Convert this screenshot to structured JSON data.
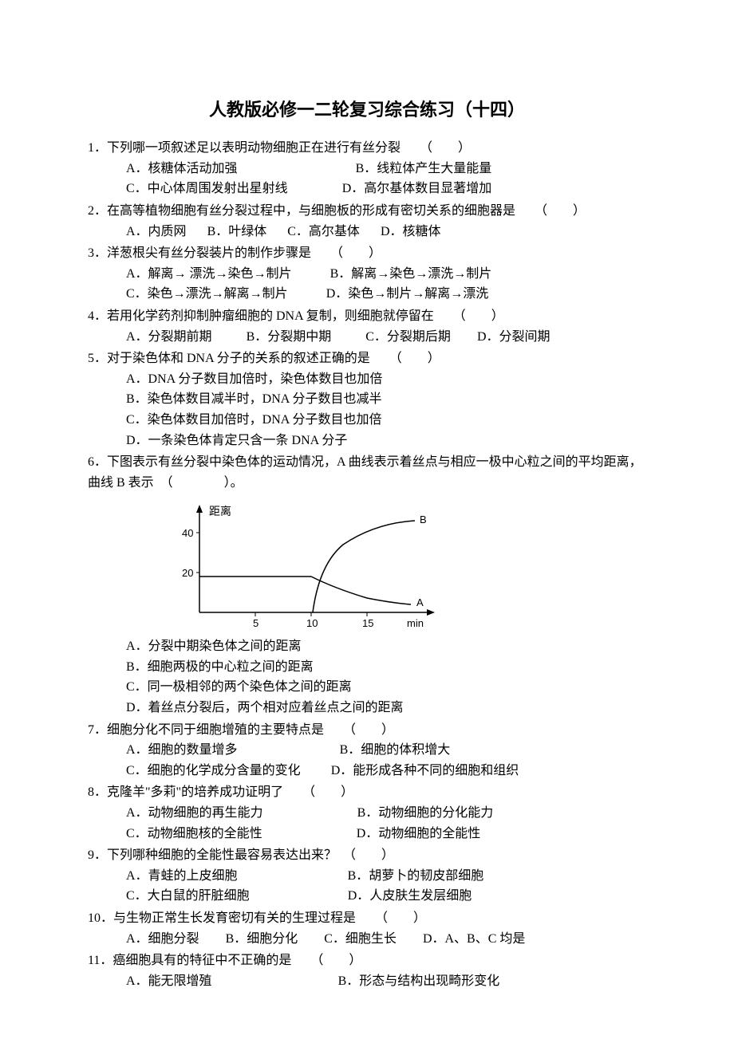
{
  "title": "人教版必修一二轮复习综合练习（十四）",
  "q1": {
    "stem": "1．下列哪一项叙述足以表明动物细胞正在进行有丝分裂　　（　　）",
    "a": "A．核糖体活动加强",
    "b": "B．线粒体产生大量能量",
    "c": "C．中心体周围发射出星射线",
    "d": "D．高尔基体数目显著增加"
  },
  "q2": {
    "stem": "2．在高等植物细胞有丝分裂过程中，与细胞板的形成有密切关系的细胞器是　　（　　）",
    "a": "A．内质网",
    "b": "B．叶绿体",
    "c": "C．高尔基体",
    "d": "D．核糖体"
  },
  "q3": {
    "stem": "3．洋葱根尖有丝分裂装片的制作步骤是　　（　　）",
    "a": "A．解离→ 漂洗→染色→制片",
    "b": "B．解离→染色→漂洗→制片",
    "c": "C．染色→漂洗→解离→制片",
    "d": "D．染色→制片→解离→漂洗"
  },
  "q4": {
    "stem": "4．若用化学药剂抑制肿瘤细胞的 DNA 复制，则细胞就停留在　　（　　）",
    "a": "A．分裂期前期",
    "b": "B．分裂期中期",
    "c": "C．分裂期后期",
    "d": "D．分裂间期"
  },
  "q5": {
    "stem": "5．对于染色体和 DNA 分子的关系的叙述正确的是　　（　　）",
    "a": "A．DNA 分子数目加倍时，染色体数目也加倍",
    "b": "B．染色体数目减半时，DNA 分子数目也减半",
    "c": "C．染色体数目加倍时，DNA 分子数目也加倍",
    "d": "D．一条染色体肯定只含一条 DNA 分子"
  },
  "q6": {
    "stem": "6．下图表示有丝分裂中染色体的运动情况，A 曲线表示着丝点与相应一极中心粒之间的平均距离，曲线 B 表示　（　　　　）。",
    "a": "A．分裂中期染色体之间的距离",
    "b": "B．细胞两极的中心粒之间的距离",
    "c": "C．同一极相邻的两个染色体之间的距离",
    "d": "D．着丝点分裂后，两个相对应着丝点之间的距离"
  },
  "q7": {
    "stem": "7．细胞分化不同于细胞增殖的主要特点是　　（　　）",
    "a": "A．细胞的数量增多",
    "b": "B．细胞的体积增大",
    "c": "C．细胞的化学成分含量的变化",
    "d": "D．能形成各种不同的细胞和组织"
  },
  "q8": {
    "stem": "8．克隆羊\"多莉\"的培养成功证明了　　（　　）",
    "a": "A．动物细胞的再生能力",
    "b": "B．动物细胞的分化能力",
    "c": "C．动物细胞核的全能性",
    "d": "D．动物细胞的全能性"
  },
  "q9": {
    "stem": "9．下列哪种细胞的全能性最容易表达出来？　（　　）",
    "a": "A．青蛙的上皮细胞",
    "b": "B．胡萝卜的韧皮部细胞",
    "c": "C．大白鼠的肝脏细胞",
    "d": "D．人皮肤生发层细胞"
  },
  "q10": {
    "stem": "10．与生物正常生长发育密切有关的生理过程是　　（　　）",
    "a": "A．细胞分裂",
    "b": "B．细胞分化",
    "c": "C．细胞生长",
    "d": "D．A、B、C 均是"
  },
  "q11": {
    "stem": "11．癌细胞具有的特征中不正确的是　　（　　）",
    "a": "A．能无限增殖",
    "b": "B．形态与结构出现畸形变化"
  },
  "chart_data": {
    "type": "line",
    "title": "",
    "xlabel": "min",
    "ylabel": "距离",
    "x_ticks": [
      5,
      10,
      15
    ],
    "y_ticks": [
      20,
      40
    ],
    "series_labels": {
      "A": "A",
      "B": "B"
    },
    "series": [
      {
        "name": "A",
        "x": [
          0,
          10,
          12,
          14,
          16,
          18
        ],
        "values": [
          18,
          18,
          12,
          8,
          5.5,
          4.5
        ]
      },
      {
        "name": "B",
        "x": [
          10,
          11,
          12,
          14,
          16,
          18
        ],
        "values": [
          0,
          14,
          25,
          34,
          39,
          41
        ]
      }
    ],
    "xlim": [
      0,
      20
    ],
    "ylim": [
      0,
      45
    ]
  }
}
